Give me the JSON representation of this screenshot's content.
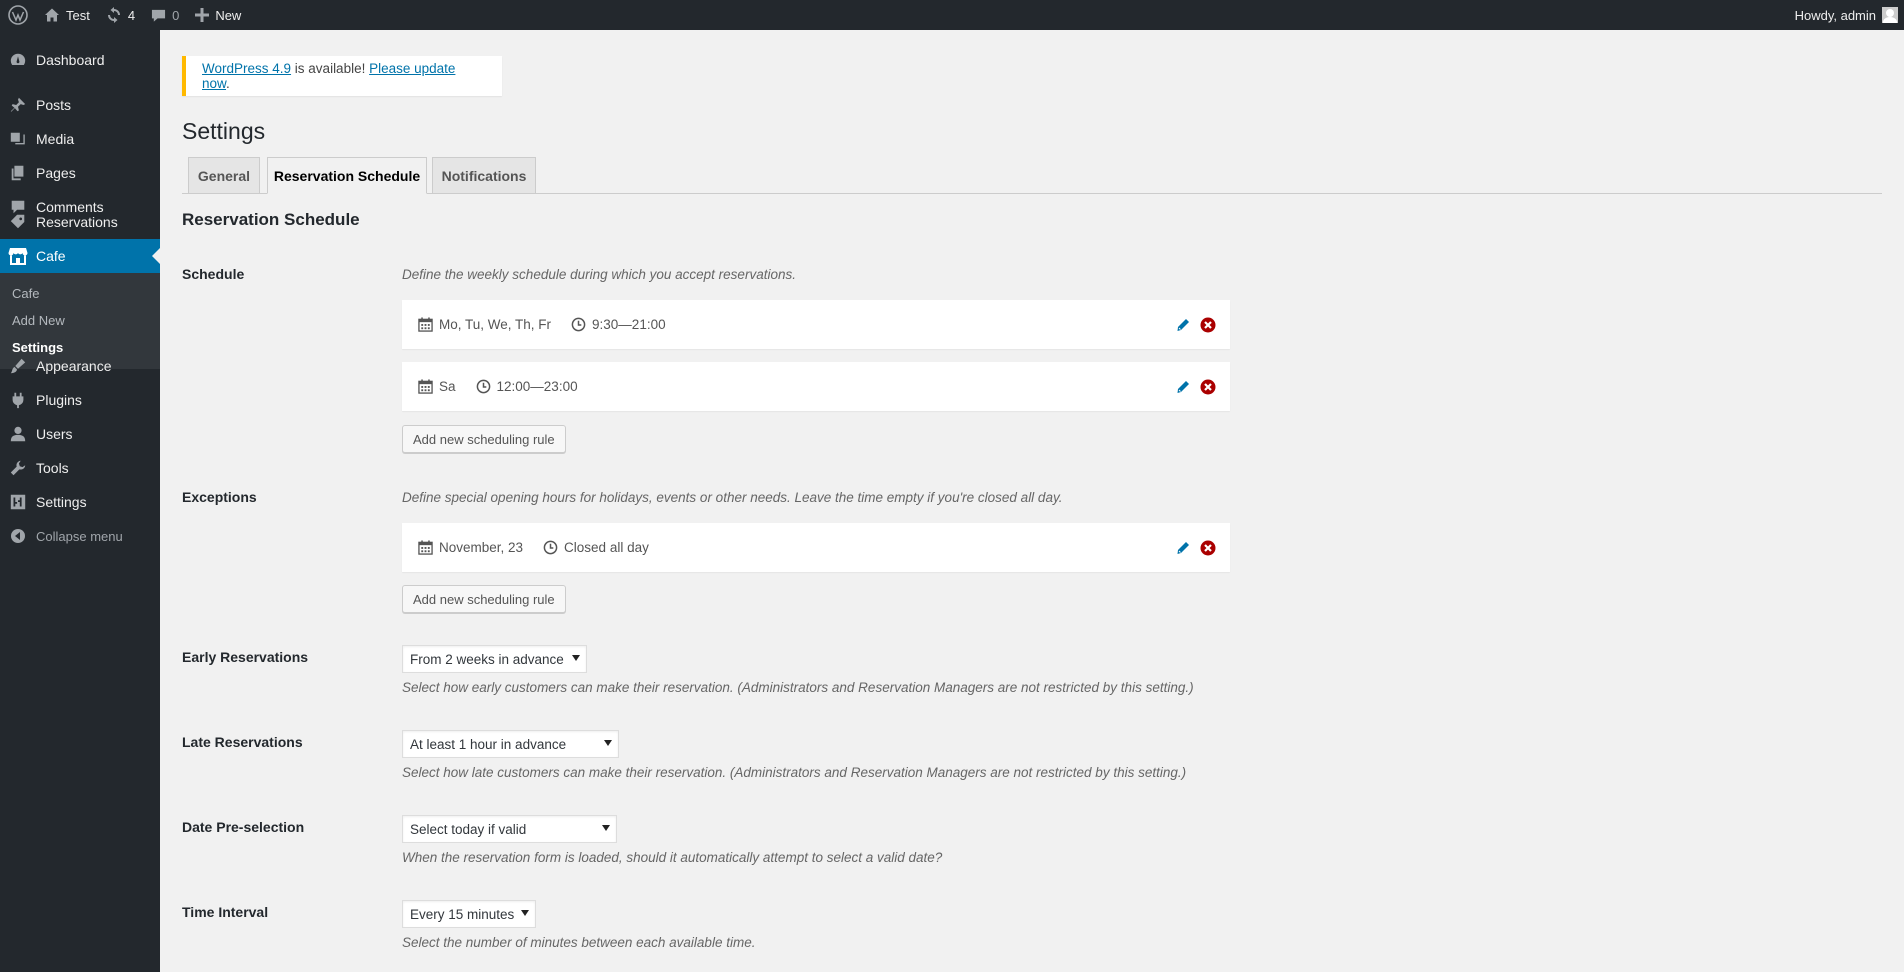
{
  "admin_bar": {
    "site_name": "Test",
    "updates_count": "4",
    "comments_count": "0",
    "new_label": "New",
    "greeting": "Howdy, admin"
  },
  "sidebar": {
    "dashboard": "Dashboard",
    "posts": "Posts",
    "media": "Media",
    "pages": "Pages",
    "comments": "Comments",
    "reservations": "Reservations",
    "cafe": "Cafe",
    "submenu": [
      "Cafe",
      "Add New",
      "Settings"
    ],
    "appearance": "Appearance",
    "plugins": "Plugins",
    "users": "Users",
    "tools": "Tools",
    "settings": "Settings",
    "collapse": "Collapse menu"
  },
  "notice": {
    "version_link": "WordPress 4.9",
    "middle": " is available! ",
    "update_link": "Please update now",
    "end": "."
  },
  "page": {
    "title": "Settings",
    "tabs": [
      "General",
      "Reservation Schedule",
      "Notifications"
    ],
    "section_title": "Reservation Schedule"
  },
  "schedule": {
    "label": "Schedule",
    "description": "Define the weekly schedule during which you accept reservations.",
    "rules": [
      {
        "days": "Mo, Tu, We, Th, Fr",
        "time": "9:30—21:00"
      },
      {
        "days": "Sa",
        "time": "12:00—23:00"
      }
    ],
    "add_button": "Add new scheduling rule"
  },
  "exceptions": {
    "label": "Exceptions",
    "description": "Define special opening hours for holidays, events or other needs. Leave the time empty if you're closed all day.",
    "rules": [
      {
        "date": "November, 23",
        "time": "Closed all day"
      }
    ],
    "add_button": "Add new scheduling rule"
  },
  "early": {
    "label": "Early Reservations",
    "value": "From 2 weeks in advance",
    "description": "Select how early customers can make their reservation. (Administrators and Reservation Managers are not restricted by this setting.)"
  },
  "late": {
    "label": "Late Reservations",
    "value": "At least 1 hour in advance",
    "description": "Select how late customers can make their reservation. (Administrators and Reservation Managers are not restricted by this setting.)"
  },
  "preselect": {
    "label": "Date Pre-selection",
    "value": "Select today if valid",
    "description": "When the reservation form is loaded, should it automatically attempt to select a valid date?"
  },
  "interval": {
    "label": "Time Interval",
    "value": "Every 15 minutes",
    "description": "Select the number of minutes between each available time."
  }
}
